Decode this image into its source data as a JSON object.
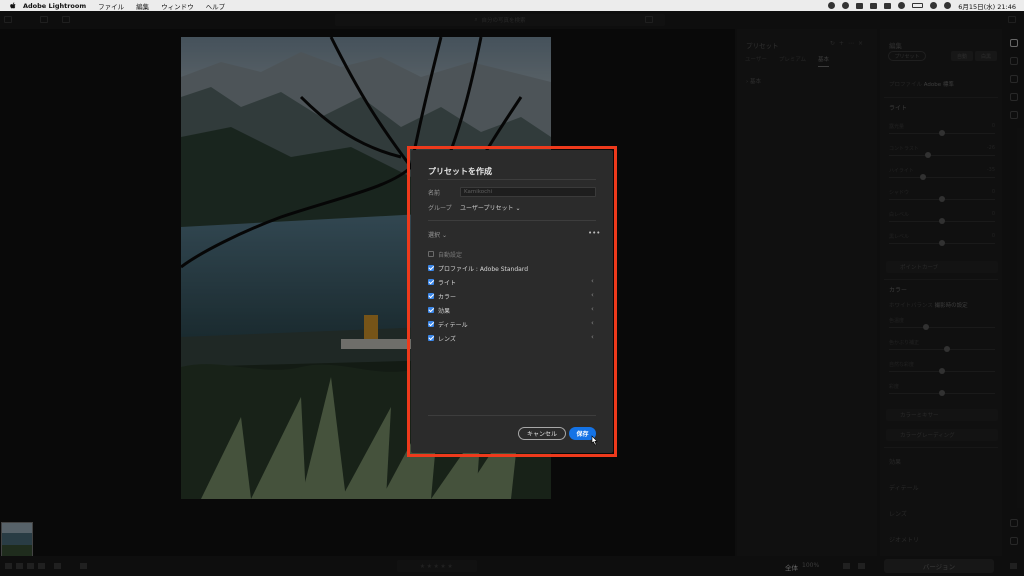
{
  "menubar": {
    "app_name": "Adobe Lightroom",
    "menus": [
      "ファイル",
      "編集",
      "ウィンドウ",
      "ヘルプ"
    ],
    "date_time": "6月15日(水) 21:46"
  },
  "topbar": {
    "search_placeholder": "自分の写真を検索"
  },
  "presets_panel": {
    "title": "プリセット",
    "tabs": [
      "ユーザー",
      "プレミアム",
      "基本"
    ],
    "group": "基本"
  },
  "edit_panel": {
    "title": "編集",
    "preset_button": "プリセット",
    "auto_button": "自動",
    "bw_button": "白黒",
    "profile_label": "プロファイル",
    "profile_value": "Adobe 標準",
    "section_light": "ライト",
    "light_sliders": [
      {
        "label": "露光量",
        "value": "0",
        "knob": 0.5
      },
      {
        "label": "コントラスト",
        "value": "-26",
        "knob": 0.37
      },
      {
        "label": "ハイライト",
        "value": "-35",
        "knob": 0.32
      },
      {
        "label": "シャドウ",
        "value": "0",
        "knob": 0.5
      },
      {
        "label": "白レベル",
        "value": "0",
        "knob": 0.5
      },
      {
        "label": "黒レベル",
        "value": "0",
        "knob": 0.5
      }
    ],
    "point_curve": "ポイントカーブ",
    "section_color": "カラー",
    "white_balance_label": "ホワイトバランス",
    "white_balance_value": "撮影時の設定",
    "color_sliders": [
      {
        "label": "色温度",
        "value": "",
        "knob": 0.35
      },
      {
        "label": "色かぶり補正",
        "value": "",
        "knob": 0.55
      },
      {
        "label": "自然な彩度",
        "value": "",
        "knob": 0.5
      },
      {
        "label": "彩度",
        "value": "",
        "knob": 0.5
      }
    ],
    "color_mixer": "カラーミキサー",
    "color_grading": "カラーグレーディング",
    "sections_rest": [
      "効果",
      "ディテール",
      "レンズ",
      "ジオメトリ"
    ]
  },
  "bottombar": {
    "stars": "★★★★★",
    "fit_label": "全体",
    "zoom": "100%",
    "version_button": "バージョン"
  },
  "dialog": {
    "title": "プリセットを作成",
    "name_label": "名前",
    "name_value": "Kamikochi",
    "group_label": "グループ",
    "group_value": "ユーザープリセット",
    "select_label": "選択",
    "more_label": "•••",
    "options": [
      {
        "label": "自動設定",
        "checked": false,
        "expandable": false
      },
      {
        "label": "プロファイル : Adobe Standard",
        "checked": true,
        "expandable": false
      },
      {
        "label": "ライト",
        "checked": true,
        "expandable": true
      },
      {
        "label": "カラー",
        "checked": true,
        "expandable": true
      },
      {
        "label": "効果",
        "checked": true,
        "expandable": true
      },
      {
        "label": "ディテール",
        "checked": true,
        "expandable": true
      },
      {
        "label": "レンズ",
        "checked": true,
        "expandable": true
      }
    ],
    "cancel_label": "キャンセル",
    "save_label": "保存"
  },
  "colors": {
    "accent_blue": "#1473e6",
    "highlight_red": "#ee3a1c",
    "dialog_bg": "#2b2b2b"
  }
}
